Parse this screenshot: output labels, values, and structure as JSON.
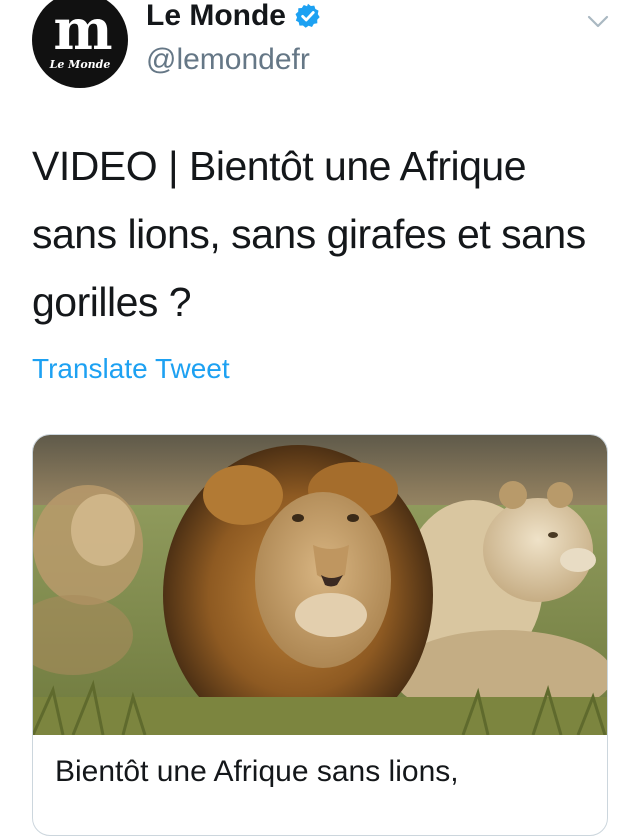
{
  "account": {
    "avatar_glyph": "m",
    "avatar_wordmark": "Le Monde",
    "display_name": "Le Monde",
    "handle": "@lemondefr",
    "verified": true
  },
  "tweet": {
    "text": "VIDEO | Bientôt une Afrique sans lions, sans girafes et sans gorilles ?",
    "translate_label": "Translate Tweet"
  },
  "card": {
    "image_subject": "lion-and-lionesses-photo",
    "title": "Bientôt une Afrique sans lions,"
  },
  "colors": {
    "link": "#1da1f2",
    "secondary_text": "#657786",
    "verified_badge": "#1da1f2",
    "card_border": "#ccd6dd"
  },
  "icons": {
    "verified": "verified-badge-icon",
    "menu": "chevron-down-icon"
  }
}
